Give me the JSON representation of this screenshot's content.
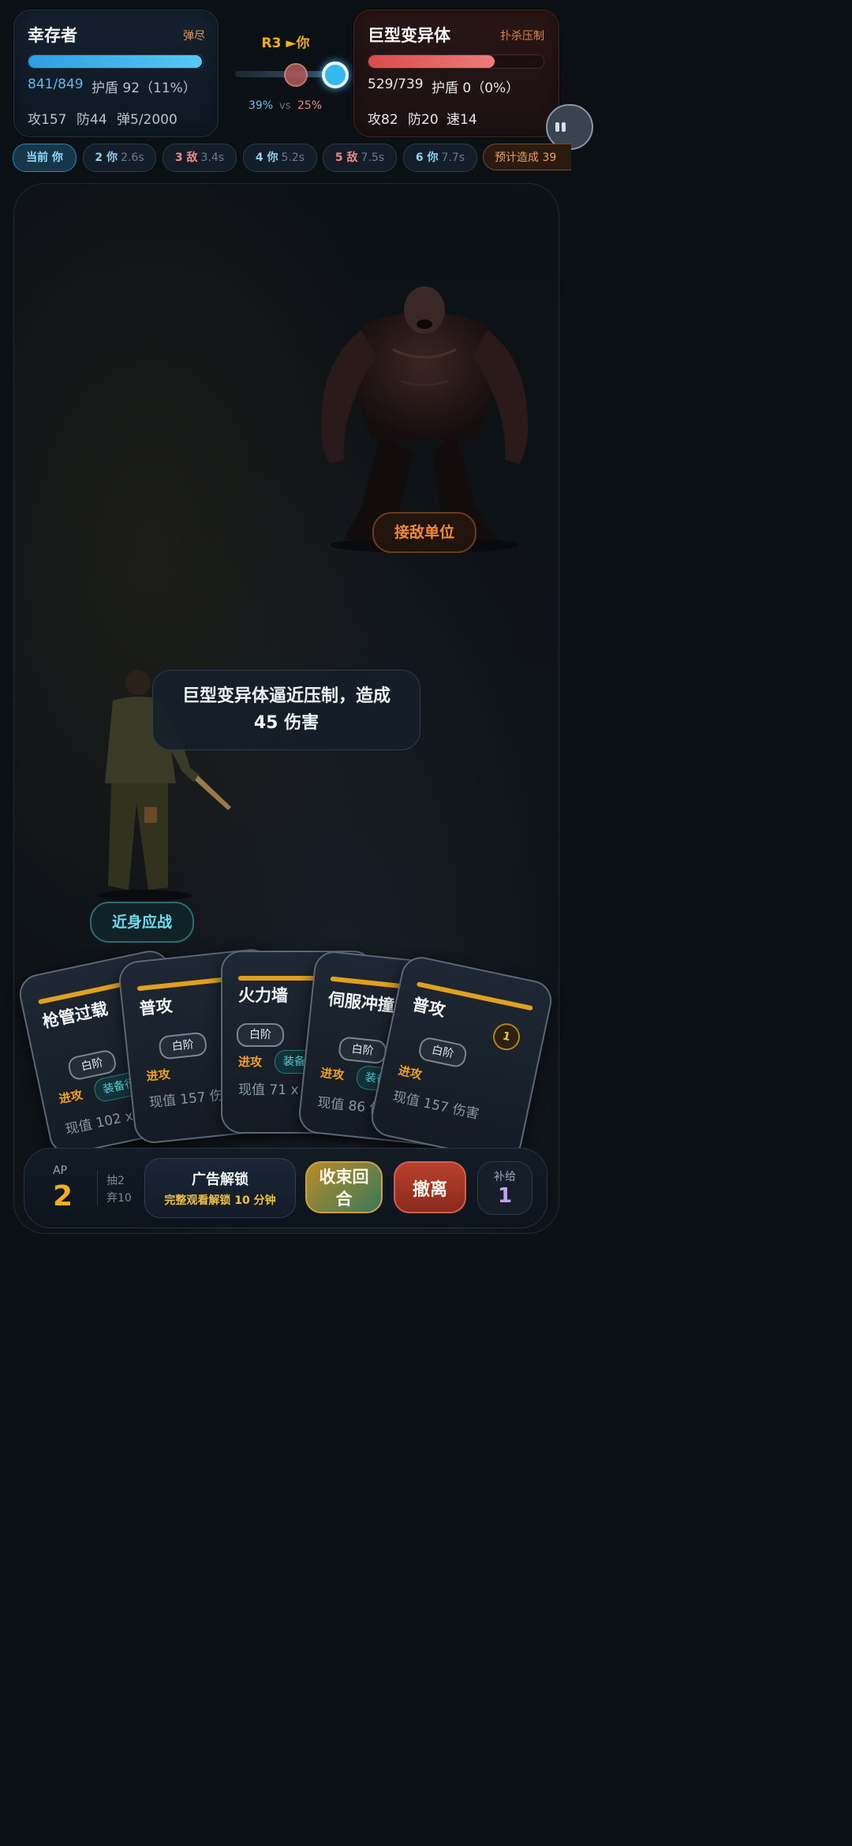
{
  "player": {
    "name": "幸存者",
    "tag": "弹尽",
    "hp_text": "841/849",
    "shield_text": "护盾 92（11%）",
    "hp_fraction": 0.99,
    "atk": "攻157",
    "def": "防44",
    "ammo": "弹5/2000"
  },
  "turn": {
    "label": "R3 ►你",
    "player_pct": "39%",
    "vs": "vs",
    "enemy_pct": "25%"
  },
  "enemy": {
    "name": "巨型变异体",
    "tag": "扑杀压制",
    "hp_text": "529/739",
    "shield_text": "护盾 0（0%）",
    "hp_fraction": 0.72,
    "atk": "攻82",
    "def": "防20",
    "spd": "速14"
  },
  "timeline": [
    {
      "label": "当前 你",
      "time": ""
    },
    {
      "label": "2 你",
      "time": "2.6s"
    },
    {
      "label": "3 敌",
      "time": "3.4s"
    },
    {
      "label": "4 你",
      "time": "5.2s"
    },
    {
      "label": "5 敌",
      "time": "7.5s"
    },
    {
      "label": "6 你",
      "time": "7.7s"
    },
    {
      "label": "预计造成 39",
      "time": ""
    }
  ],
  "arena": {
    "enemy_label": "接敌单位",
    "player_label": "近身应战",
    "message": "巨型变异体逼近压制，造成 45 伤害"
  },
  "cards": [
    {
      "title": "枪管过载",
      "tier": "白阶",
      "kind": "进攻",
      "equip": "装备行",
      "value": "现值 102 x 2"
    },
    {
      "title": "普攻",
      "tier": "白阶",
      "kind": "进攻",
      "equip": "",
      "value": "现值 157 伤害"
    },
    {
      "title": "火力墙",
      "tier": "白阶",
      "kind": "进攻",
      "equip": "装备行",
      "value": "现值 71 x 3"
    },
    {
      "title": "伺服冲撞",
      "tier": "白阶",
      "kind": "进攻",
      "equip": "装备行",
      "value": "现值 86 伤害"
    },
    {
      "title": "普攻",
      "tier": "白阶",
      "kind": "进攻",
      "equip": "",
      "value": "现值 157 伤害",
      "cost": "1"
    }
  ],
  "bottom": {
    "ap_label": "AP",
    "ap_value": "2",
    "draw": "抽2",
    "discard": "弃10",
    "ad_title": "广告解锁",
    "ad_sub": "完整观看解锁 10 分钟",
    "end_turn": "收束回合",
    "retreat": "撤离",
    "supply_label": "补给",
    "supply_value": "1"
  },
  "colors": {
    "player_hp": "#3fb4ee",
    "enemy_hp": "#e05a5a",
    "accent_gold": "#f0b020",
    "accent_cyan": "#5fd8e8"
  }
}
